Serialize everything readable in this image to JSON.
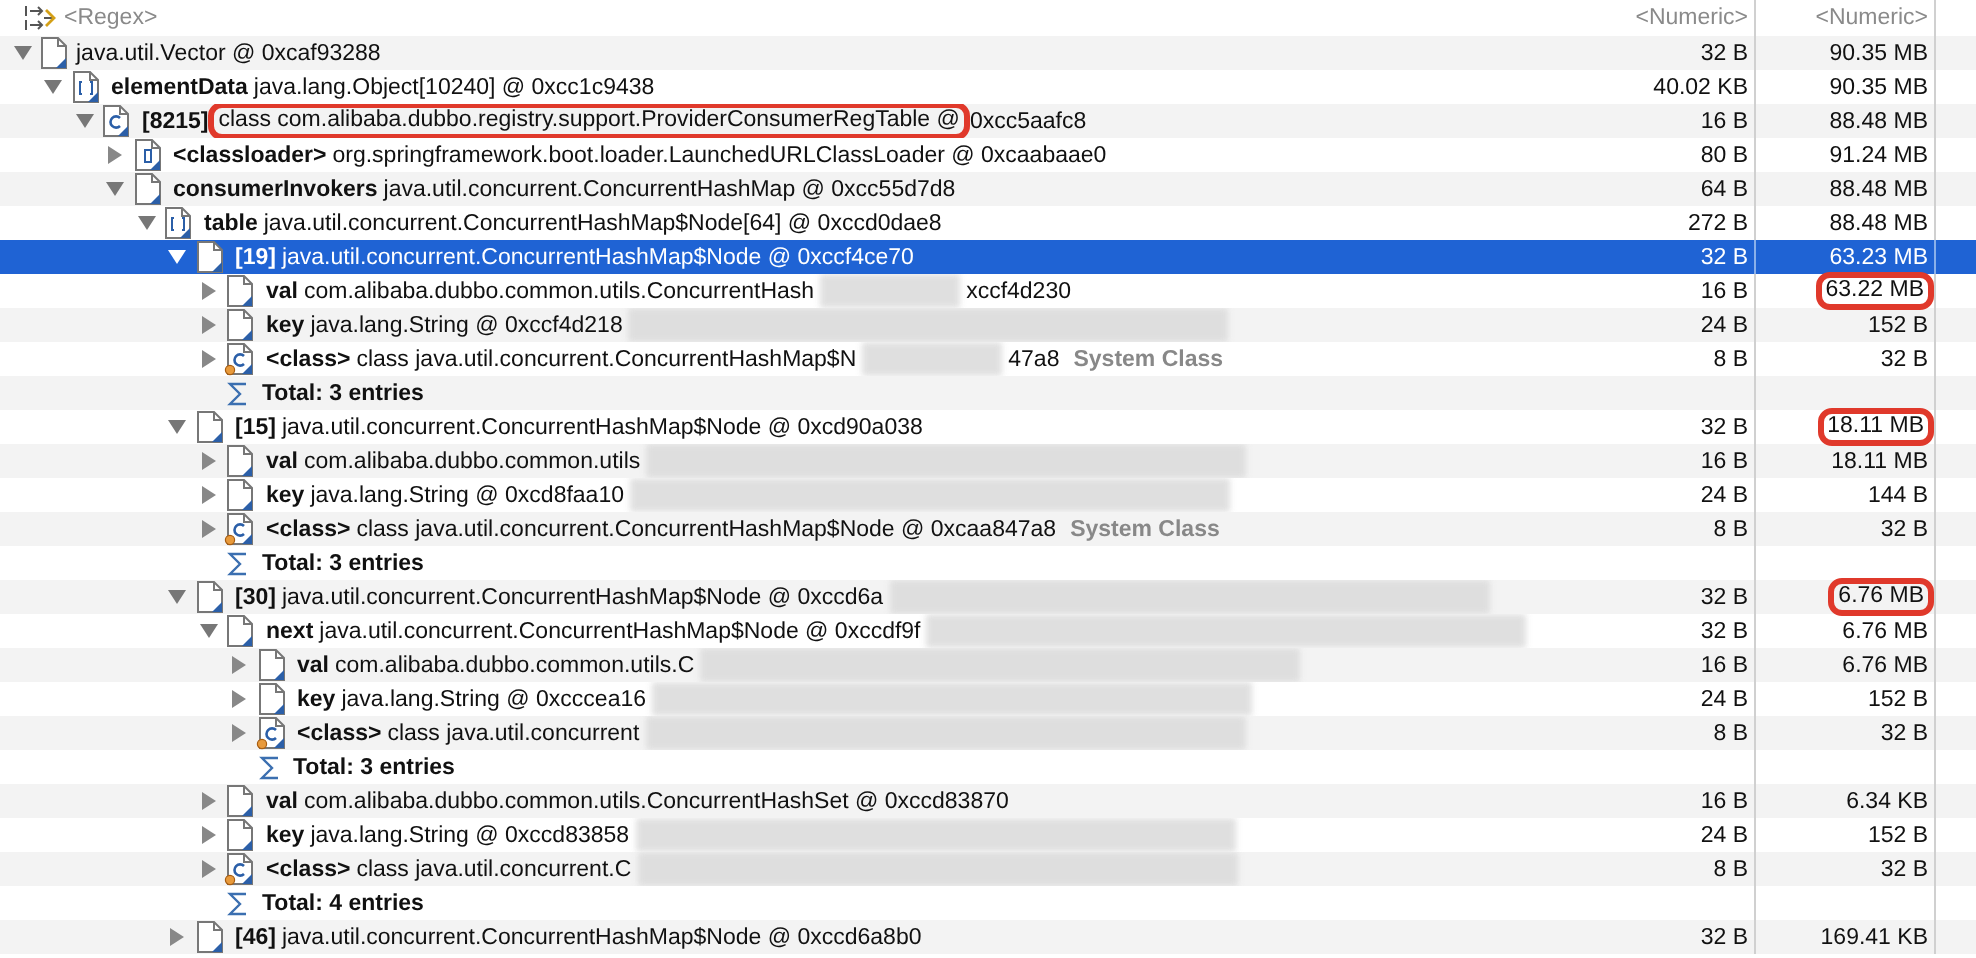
{
  "header": {
    "name_filter": "<Regex>",
    "shallow_filter": "<Numeric>",
    "retained_filter": "<Numeric>"
  },
  "tree": [
    {
      "kind": "object",
      "text": "java.util.Vector @ 0xcaf93288",
      "shallow": "32 B",
      "retained": "90.35 MB",
      "expanded": true,
      "selected": false,
      "children": [
        {
          "kind": "array",
          "name": "elementData",
          "text": "java.lang.Object[10240] @ 0xcc1c9438",
          "shallow": "40.02 KB",
          "retained": "90.35 MB",
          "expanded": true,
          "selected": false,
          "children": [
            {
              "kind": "class",
              "name": "[8215]",
              "text": "class com.alibaba.dubbo.registry.support.ProviderConsumerRegTable @",
              "text_after": "0xcc5aafc8",
              "highlight_text": true,
              "shallow": "16 B",
              "retained": "88.48 MB",
              "expanded": true,
              "selected": false,
              "children": [
                {
                  "kind": "classloader",
                  "name": "<classloader>",
                  "text": "org.springframework.boot.loader.LaunchedURLClassLoader @ 0xcaabaae0",
                  "shallow": "80 B",
                  "retained": "91.24 MB",
                  "expanded": false,
                  "selected": false
                },
                {
                  "kind": "object",
                  "name": "consumerInvokers",
                  "text": "java.util.concurrent.ConcurrentHashMap @ 0xcc55d7d8",
                  "shallow": "64 B",
                  "retained": "88.48 MB",
                  "expanded": true,
                  "selected": false,
                  "children": [
                    {
                      "kind": "array",
                      "name": "table",
                      "text": "java.util.concurrent.ConcurrentHashMap$Node[64] @ 0xccd0dae8",
                      "shallow": "272 B",
                      "retained": "88.48 MB",
                      "expanded": true,
                      "selected": false,
                      "children": [
                        {
                          "kind": "object",
                          "name": "[19]",
                          "text": "java.util.concurrent.ConcurrentHashMap$Node @ 0xccf4ce70",
                          "shallow": "32 B",
                          "retained": "63.23 MB",
                          "expanded": true,
                          "selected": true,
                          "children": [
                            {
                              "kind": "object",
                              "name": "val",
                              "text": "com.alibaba.dubbo.common.utils.ConcurrentHash",
                              "redacted": true,
                              "text_after": "xccf4d230",
                              "shallow": "16 B",
                              "retained": "63.22 MB",
                              "highlight_retained": true,
                              "expanded": false,
                              "selected": false
                            },
                            {
                              "kind": "object",
                              "name": "key",
                              "text": "java.lang.String @ 0xccf4d218",
                              "redacted": true,
                              "shallow": "24 B",
                              "retained": "152 B",
                              "expanded": false,
                              "selected": false
                            },
                            {
                              "kind": "class",
                              "name": "<class>",
                              "text": "class java.util.concurrent.ConcurrentHashMap$N",
                              "redacted": true,
                              "text_after": "47a8",
                              "extra": "System Class",
                              "shallow": "8 B",
                              "retained": "32 B",
                              "expanded": false,
                              "selected": false
                            },
                            {
                              "kind": "total",
                              "name": "Total: 3 entries",
                              "selected": false
                            }
                          ]
                        },
                        {
                          "kind": "object",
                          "name": "[15]",
                          "text": "java.util.concurrent.ConcurrentHashMap$Node @ 0xcd90a038",
                          "shallow": "32 B",
                          "retained": "18.11 MB",
                          "highlight_retained": true,
                          "expanded": true,
                          "selected": false,
                          "children": [
                            {
                              "kind": "object",
                              "name": "val",
                              "text": "com.alibaba.dubbo.common.utils",
                              "redacted": true,
                              "shallow": "16 B",
                              "retained": "18.11 MB",
                              "expanded": false,
                              "selected": false
                            },
                            {
                              "kind": "object",
                              "name": "key",
                              "text": "java.lang.String @ 0xcd8faa10",
                              "redacted": true,
                              "shallow": "24 B",
                              "retained": "144 B",
                              "expanded": false,
                              "selected": false
                            },
                            {
                              "kind": "class",
                              "name": "<class>",
                              "text": "class java.util.concurrent.ConcurrentHashMap$Node @ 0xcaa847a8",
                              "extra": "System Class",
                              "shallow": "8 B",
                              "retained": "32 B",
                              "expanded": false,
                              "selected": false
                            },
                            {
                              "kind": "total",
                              "name": "Total: 3 entries",
                              "selected": false
                            }
                          ]
                        },
                        {
                          "kind": "object",
                          "name": "[30]",
                          "text": "java.util.concurrent.ConcurrentHashMap$Node @ 0xccd6a",
                          "redacted": true,
                          "shallow": "32 B",
                          "retained": "6.76 MB",
                          "highlight_retained": true,
                          "expanded": true,
                          "selected": false,
                          "children": [
                            {
                              "kind": "object",
                              "name": "next",
                              "text": "java.util.concurrent.ConcurrentHashMap$Node @ 0xccdf9f",
                              "redacted": true,
                              "shallow": "32 B",
                              "retained": "6.76 MB",
                              "expanded": true,
                              "selected": false,
                              "children": [
                                {
                                  "kind": "object",
                                  "name": "val",
                                  "text": "com.alibaba.dubbo.common.utils.C",
                                  "redacted": true,
                                  "shallow": "16 B",
                                  "retained": "6.76 MB",
                                  "expanded": false,
                                  "selected": false
                                },
                                {
                                  "kind": "object",
                                  "name": "key",
                                  "text": "java.lang.String @ 0xcccea16",
                                  "redacted": true,
                                  "shallow": "24 B",
                                  "retained": "152 B",
                                  "expanded": false,
                                  "selected": false
                                },
                                {
                                  "kind": "class",
                                  "name": "<class>",
                                  "text": "class java.util.concurrent",
                                  "redacted": true,
                                  "shallow": "8 B",
                                  "retained": "32 B",
                                  "expanded": false,
                                  "selected": false
                                },
                                {
                                  "kind": "total",
                                  "name": "Total: 3 entries",
                                  "selected": false
                                }
                              ]
                            },
                            {
                              "kind": "object",
                              "name": "val",
                              "text": "com.alibaba.dubbo.common.utils.ConcurrentHashSet @ 0xccd83870",
                              "shallow": "16 B",
                              "retained": "6.34 KB",
                              "expanded": false,
                              "selected": false
                            },
                            {
                              "kind": "object",
                              "name": "key",
                              "text": "java.lang.String @ 0xccd83858",
                              "redacted": true,
                              "shallow": "24 B",
                              "retained": "152 B",
                              "expanded": false,
                              "selected": false
                            },
                            {
                              "kind": "class",
                              "name": "<class>",
                              "text": "class java.util.concurrent.C",
                              "redacted": true,
                              "shallow": "8 B",
                              "retained": "32 B",
                              "expanded": false,
                              "selected": false
                            },
                            {
                              "kind": "total",
                              "name": "Total: 4 entries",
                              "selected": false
                            }
                          ]
                        },
                        {
                          "kind": "object",
                          "name": "[46]",
                          "text": "java.util.concurrent.ConcurrentHashMap$Node @ 0xccd6a8b0",
                          "shallow": "32 B",
                          "retained": "169.41 KB",
                          "expanded": false,
                          "selected": false
                        }
                      ]
                    }
                  ]
                }
              ]
            }
          ]
        }
      ]
    }
  ]
}
